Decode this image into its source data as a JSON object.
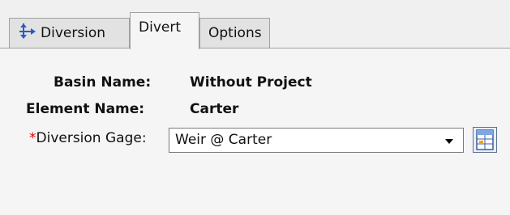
{
  "tabs": [
    {
      "label": "Diversion",
      "icon": "diversion-arrows-icon"
    },
    {
      "label": "Divert"
    },
    {
      "label": "Options"
    }
  ],
  "active_tab": "Divert",
  "basin": {
    "label": "Basin Name:",
    "value": "Without Project"
  },
  "element": {
    "label": "Element Name:",
    "value": "Carter"
  },
  "gage": {
    "required_marker": "*",
    "label": "Diversion Gage:",
    "selected": "Weir @ Carter",
    "button_icon": "time-series-table-icon"
  },
  "colors": {
    "required": "#e00000",
    "accent": "#3b5fa0"
  }
}
